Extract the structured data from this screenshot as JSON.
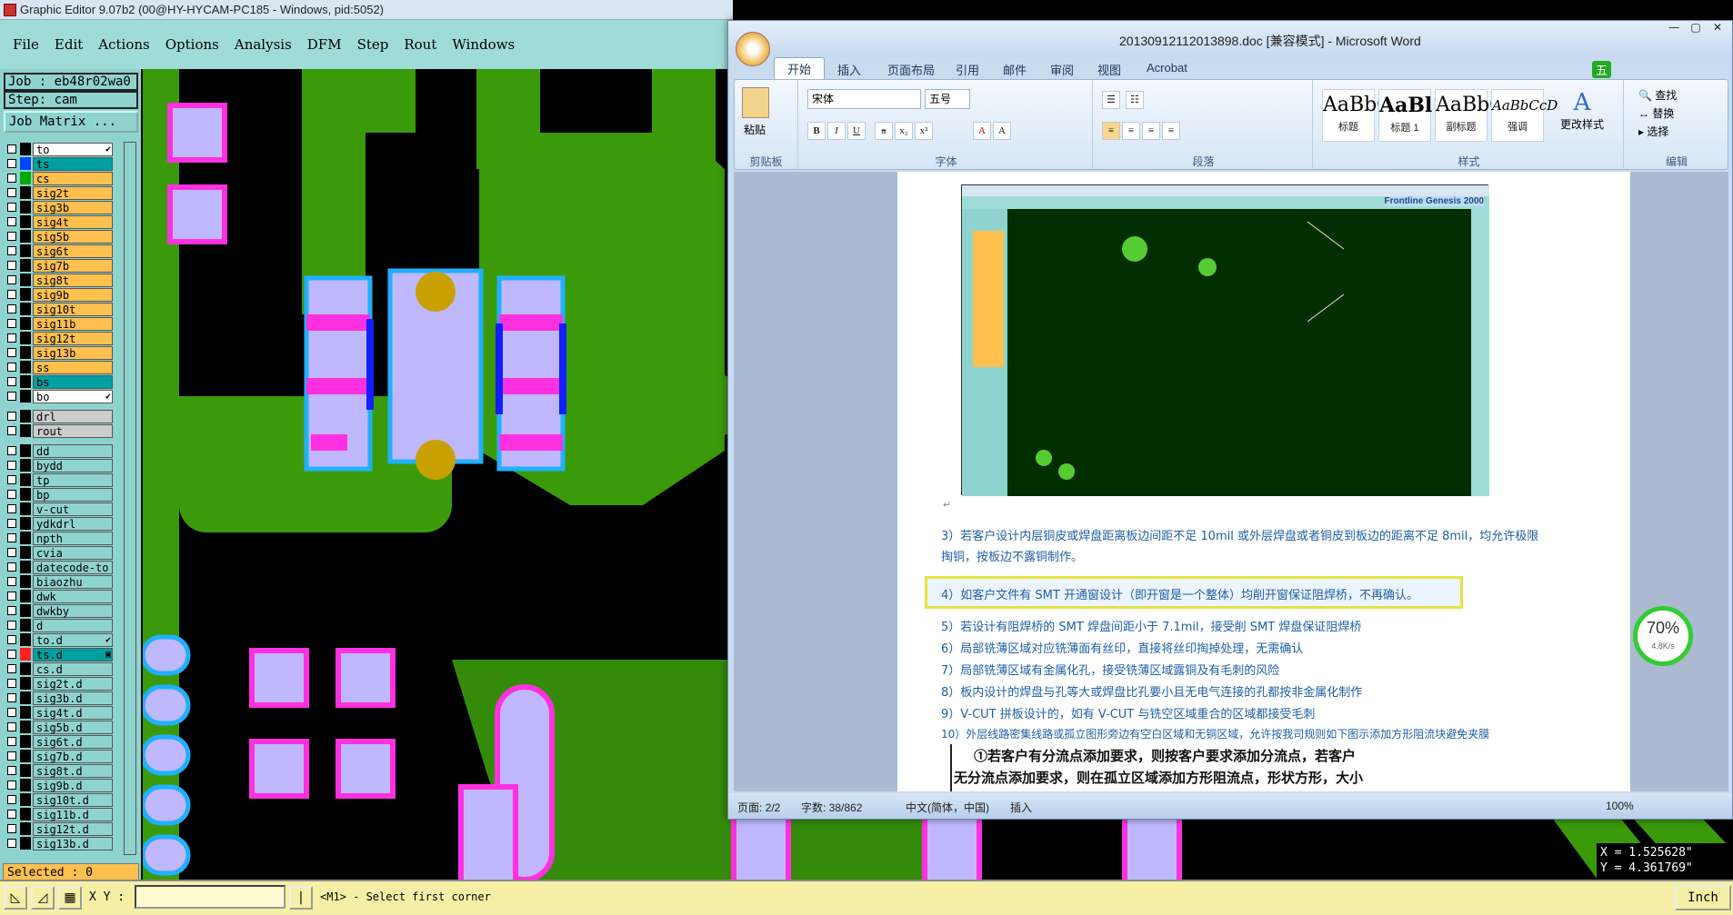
{
  "graphic_editor": {
    "title": "Graphic Editor 9.07b2 (00@HY-HYCAM-PC185 - Windows, pid:5052)",
    "menu": [
      "File",
      "Edit",
      "Actions",
      "Options",
      "Analysis",
      "DFM",
      "Step",
      "Rout",
      "Windows"
    ],
    "job": "Job : eb48r02wa0",
    "step": "Step: cam",
    "job_matrix": "Job Matrix ...",
    "layers": [
      {
        "name": "to",
        "bg": "#ffffff",
        "swatch": "#000000",
        "marker": "✔"
      },
      {
        "name": "ts",
        "bg": "#00a0a0",
        "swatch": "#0044ff",
        "marker": ""
      },
      {
        "name": "cs",
        "bg": "#ffc04d",
        "swatch": "#00aa00",
        "marker": ""
      },
      {
        "name": "sig2t",
        "bg": "#ffc04d",
        "swatch": "#000000",
        "marker": ""
      },
      {
        "name": "sig3b",
        "bg": "#ffc04d",
        "swatch": "#000000",
        "marker": ""
      },
      {
        "name": "sig4t",
        "bg": "#ffc04d",
        "swatch": "#000000",
        "marker": ""
      },
      {
        "name": "sig5b",
        "bg": "#ffc04d",
        "swatch": "#000000",
        "marker": ""
      },
      {
        "name": "sig6t",
        "bg": "#ffc04d",
        "swatch": "#000000",
        "marker": ""
      },
      {
        "name": "sig7b",
        "bg": "#ffc04d",
        "swatch": "#000000",
        "marker": ""
      },
      {
        "name": "sig8t",
        "bg": "#ffc04d",
        "swatch": "#000000",
        "marker": ""
      },
      {
        "name": "sig9b",
        "bg": "#ffc04d",
        "swatch": "#000000",
        "marker": ""
      },
      {
        "name": "sig10t",
        "bg": "#ffc04d",
        "swatch": "#000000",
        "marker": ""
      },
      {
        "name": "sig11b",
        "bg": "#ffc04d",
        "swatch": "#000000",
        "marker": ""
      },
      {
        "name": "sig12t",
        "bg": "#ffc04d",
        "swatch": "#000000",
        "marker": ""
      },
      {
        "name": "sig13b",
        "bg": "#ffc04d",
        "swatch": "#000000",
        "marker": ""
      },
      {
        "name": "ss",
        "bg": "#ffc04d",
        "swatch": "#000000",
        "marker": ""
      },
      {
        "name": "bs",
        "bg": "#00a0a0",
        "swatch": "#000000",
        "marker": ""
      },
      {
        "name": "bo",
        "bg": "#ffffff",
        "swatch": "#000000",
        "marker": "✔"
      }
    ],
    "drill_layers": [
      {
        "name": "drl",
        "bg": "#cccccc",
        "swatch": "#000000",
        "marker": ""
      },
      {
        "name": "rout",
        "bg": "#cccccc",
        "swatch": "#000000",
        "marker": ""
      }
    ],
    "misc_layers": [
      {
        "name": "dd",
        "bg": "#8fd3cf",
        "swatch": "#000000",
        "marker": ""
      },
      {
        "name": "bydd",
        "bg": "#8fd3cf",
        "swatch": "#000000",
        "marker": ""
      },
      {
        "name": "tp",
        "bg": "#8fd3cf",
        "swatch": "#000000",
        "marker": ""
      },
      {
        "name": "bp",
        "bg": "#8fd3cf",
        "swatch": "#000000",
        "marker": ""
      },
      {
        "name": "v-cut",
        "bg": "#8fd3cf",
        "swatch": "#000000",
        "marker": ""
      },
      {
        "name": "ydkdrl",
        "bg": "#8fd3cf",
        "swatch": "#000000",
        "marker": ""
      },
      {
        "name": "npth",
        "bg": "#8fd3cf",
        "swatch": "#000000",
        "marker": ""
      },
      {
        "name": "cvia",
        "bg": "#8fd3cf",
        "swatch": "#000000",
        "marker": ""
      },
      {
        "name": "datecode-to",
        "bg": "#8fd3cf",
        "swatch": "#000000",
        "marker": ""
      },
      {
        "name": "biaozhu",
        "bg": "#8fd3cf",
        "swatch": "#000000",
        "marker": ""
      },
      {
        "name": "dwk",
        "bg": "#8fd3cf",
        "swatch": "#000000",
        "marker": ""
      },
      {
        "name": "dwkby",
        "bg": "#8fd3cf",
        "swatch": "#000000",
        "marker": ""
      },
      {
        "name": "d",
        "bg": "#8fd3cf",
        "swatch": "#000000",
        "marker": ""
      },
      {
        "name": "to.d",
        "bg": "#8fd3cf",
        "swatch": "#000000",
        "marker": "✔"
      },
      {
        "name": "ts.d",
        "bg": "#00a0a0",
        "swatch": "#ff2020",
        "marker": "▣"
      },
      {
        "name": "cs.d",
        "bg": "#8fd3cf",
        "swatch": "#000000",
        "marker": ""
      },
      {
        "name": "sig2t.d",
        "bg": "#8fd3cf",
        "swatch": "#000000",
        "marker": ""
      },
      {
        "name": "sig3b.d",
        "bg": "#8fd3cf",
        "swatch": "#000000",
        "marker": ""
      },
      {
        "name": "sig4t.d",
        "bg": "#8fd3cf",
        "swatch": "#000000",
        "marker": ""
      },
      {
        "name": "sig5b.d",
        "bg": "#8fd3cf",
        "swatch": "#000000",
        "marker": ""
      },
      {
        "name": "sig6t.d",
        "bg": "#8fd3cf",
        "swatch": "#000000",
        "marker": ""
      },
      {
        "name": "sig7b.d",
        "bg": "#8fd3cf",
        "swatch": "#000000",
        "marker": ""
      },
      {
        "name": "sig8t.d",
        "bg": "#8fd3cf",
        "swatch": "#000000",
        "marker": ""
      },
      {
        "name": "sig9b.d",
        "bg": "#8fd3cf",
        "swatch": "#000000",
        "marker": ""
      },
      {
        "name": "sig10t.d",
        "bg": "#8fd3cf",
        "swatch": "#000000",
        "marker": ""
      },
      {
        "name": "sig11b.d",
        "bg": "#8fd3cf",
        "swatch": "#000000",
        "marker": ""
      },
      {
        "name": "sig12t.d",
        "bg": "#8fd3cf",
        "swatch": "#000000",
        "marker": ""
      },
      {
        "name": "sig13b.d",
        "bg": "#8fd3cf",
        "swatch": "#000000",
        "marker": ""
      }
    ],
    "selected": "Selected : 0",
    "xy_label": "X Y :",
    "prompt": "<M1> - Select first corner",
    "unit": "Inch",
    "coord_x": "X = 1.525628\"",
    "coord_y": "Y = 4.361769\"",
    "colors": {
      "copper": "#3a9a0a",
      "pad": "#c0b8ff",
      "mask": "#ff30e0",
      "outline": "#20b0ff"
    }
  },
  "word": {
    "title": "20130912112013898.doc [兼容模式] - Microsoft Word",
    "tabs": [
      "开始",
      "插入",
      "页面布局",
      "引用",
      "邮件",
      "审阅",
      "视图",
      "Acrobat"
    ],
    "font_name": "宋体",
    "font_size": "五号",
    "paste_label": "粘贴",
    "groups": [
      "剪贴板",
      "字体",
      "段落",
      "样式",
      "编辑"
    ],
    "styles": [
      {
        "sample": "AaBbC",
        "label": "标题"
      },
      {
        "sample": "AaBl",
        "label": "标题 1"
      },
      {
        "sample": "AaBbC",
        "label": "副标题"
      },
      {
        "sample": "AaBbCcD",
        "label": "强调"
      }
    ],
    "change_styles": "更改样式",
    "editing": [
      "查找",
      "替换",
      "选择"
    ],
    "ime": "五",
    "embedded_title": "Frontline Genesis 2000",
    "paragraphs": [
      "3）若客户设计内层铜皮或焊盘距离板边间距不足 10mil 或外层焊盘或者铜皮到板边的距离不足 8mil，均允许极限",
      "掏铜，按板边不露铜制作。",
      "4）如客户文件有 SMT 开通窗设计（即开窗是一个整体）均削开窗保证阻焊桥，不再确认。",
      "5）若设计有阻焊桥的 SMT 焊盘间距小于 7.1mil，接受削 SMT 焊盘保证阻焊桥",
      "6）局部铣薄区域对应铣薄面有丝印，直接将丝印掏掉处理，无需确认",
      "7）局部铣薄区域有金属化孔，接受铣薄区域露铜及有毛刺的风险",
      "8）板内设计的焊盘与孔等大或焊盘比孔要小且无电气连接的孔都按非金属化制作",
      "9）V-CUT 拼板设计的，如有 V-CUT 与铣空区域重合的区域都接受毛刺",
      "10）外层线路密集线路或孤立图形旁边有空白区域和无铜区域，允许按我司规则如下图示添加方形阻流块避免夹膜"
    ],
    "boxed_1": "①若客户有分流点添加要求，则按客户要求添加分流点，若客户",
    "boxed_2": "无分流点添加要求，则在孤立区域添加方形阻流点，形状方形，大小",
    "status_page": "页面: 2/2",
    "status_words": "字数: 38/862",
    "status_lang": "中文(简体，中国)",
    "status_mode": "插入",
    "zoom": "100%"
  },
  "gauge": {
    "value": "70%",
    "speed": "4.8K/s"
  }
}
